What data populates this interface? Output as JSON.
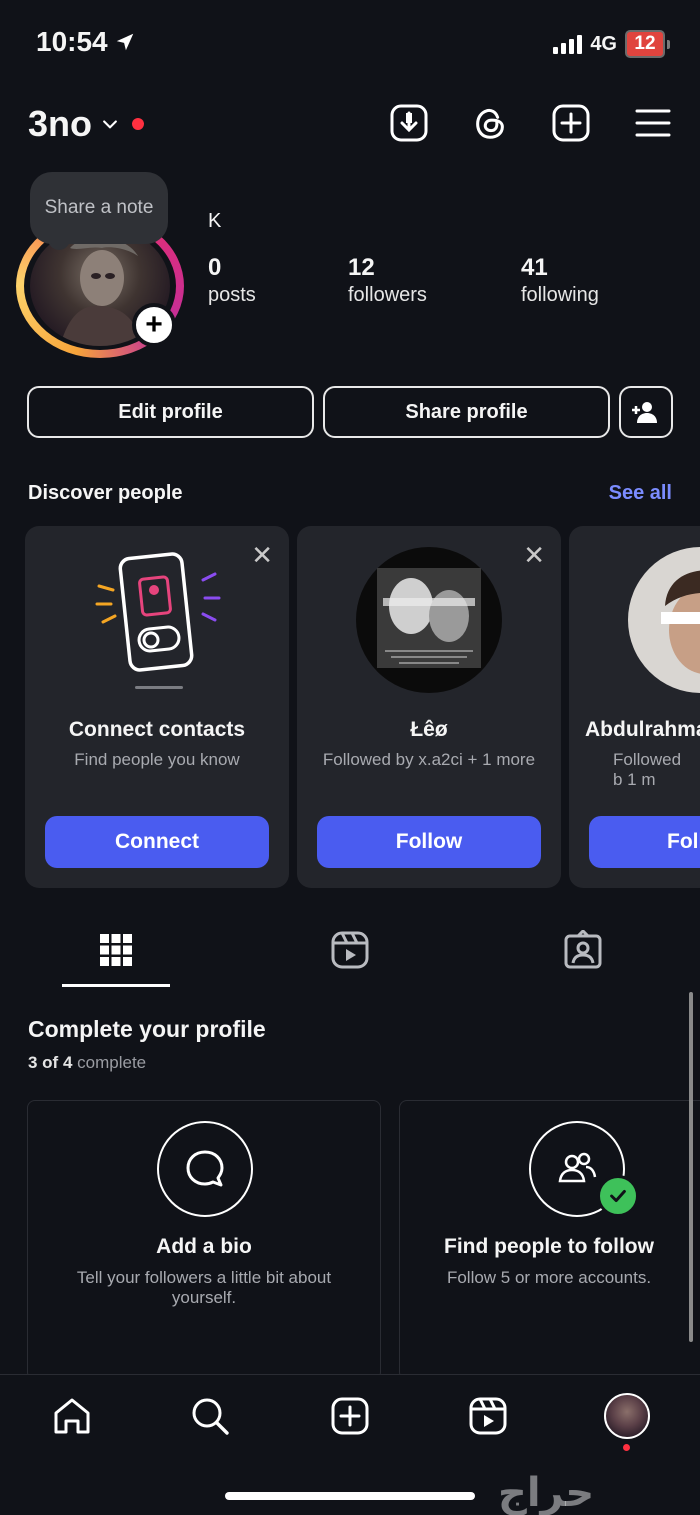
{
  "status_bar": {
    "time": "10:54",
    "network": "4G",
    "battery": "12"
  },
  "header": {
    "username": "3no"
  },
  "profile": {
    "note_placeholder": "Share a note",
    "display_name": "K",
    "stats": [
      {
        "value": "0",
        "label": "posts"
      },
      {
        "value": "12",
        "label": "followers"
      },
      {
        "value": "41",
        "label": "following"
      }
    ],
    "edit_label": "Edit profile",
    "share_label": "Share profile"
  },
  "discover": {
    "title": "Discover people",
    "see_all": "See all",
    "cards": [
      {
        "title": "Connect contacts",
        "subtitle": "Find people you know",
        "button": "Connect"
      },
      {
        "title": "Łêø",
        "subtitle": "Followed by x.a2ci + 1 more",
        "button": "Follow"
      },
      {
        "title": "Abdulrahma",
        "subtitle": "Followed b 1 m",
        "button": "Foll"
      }
    ]
  },
  "complete_profile": {
    "title": "Complete your profile",
    "progress_done": "3 of 4",
    "progress_suffix": "complete",
    "cards": [
      {
        "title": "Add a bio",
        "subtitle": "Tell your followers a little bit about yourself."
      },
      {
        "title": "Find people to follow",
        "subtitle": "Follow 5 or more accounts."
      }
    ]
  },
  "watermark": "حراج",
  "colors": {
    "accent": "#4a5cf0",
    "link": "#7b8cff",
    "notification": "#ff3040",
    "check": "#3ec15a"
  }
}
